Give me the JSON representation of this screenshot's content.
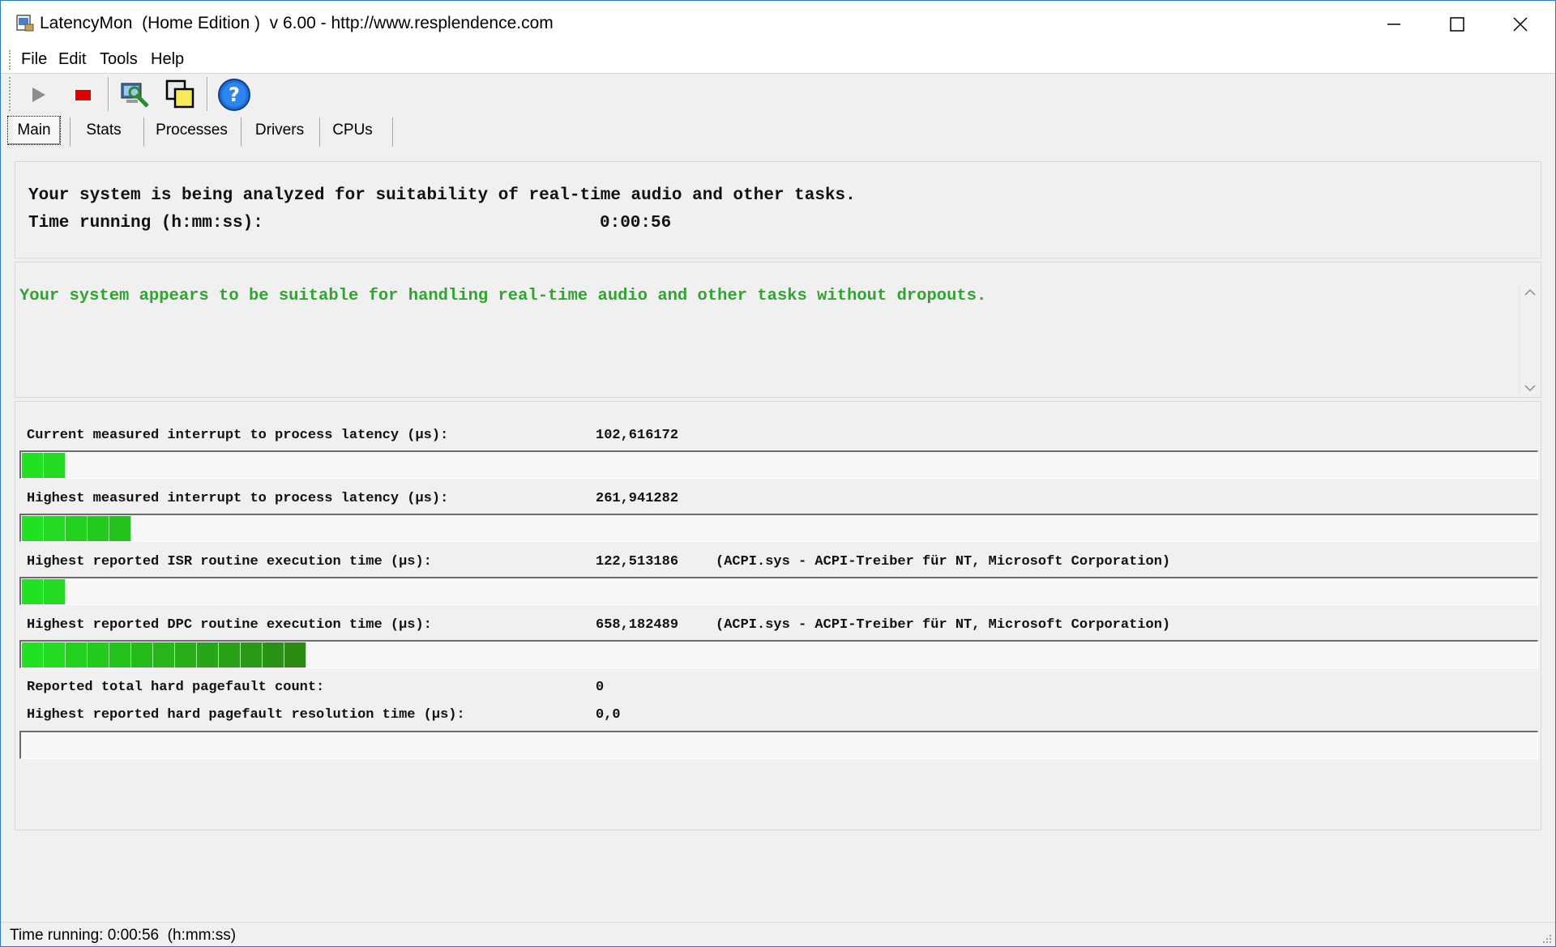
{
  "window": {
    "title": "LatencyMon  (Home Edition )  v 6.00 - http://www.resplendence.com",
    "minimize_icon": "minimize-icon",
    "maximize_icon": "maximize-icon",
    "close_icon": "close-icon"
  },
  "menu": {
    "items": [
      "File",
      "Edit",
      "Tools",
      "Help"
    ]
  },
  "toolbar": {
    "buttons": [
      {
        "name": "start",
        "icon": "play-icon"
      },
      {
        "name": "stop",
        "icon": "stop-icon"
      },
      {
        "name": "analyze",
        "icon": "computer-analyze-icon"
      },
      {
        "name": "windows",
        "icon": "window-stack-icon"
      },
      {
        "name": "help",
        "icon": "help-icon"
      }
    ]
  },
  "tabs": [
    {
      "label": "Main",
      "active": true
    },
    {
      "label": "Stats",
      "active": false
    },
    {
      "label": "Processes",
      "active": false
    },
    {
      "label": "Drivers",
      "active": false
    },
    {
      "label": "CPUs",
      "active": false
    }
  ],
  "main": {
    "analysis_text": "Your system is being analyzed for suitability of real-time audio and other tasks.",
    "time_label": "Time running (h:mm:ss):",
    "time_value": "0:00:56",
    "verdict": "Your system appears to be suitable for handling real-time audio and other tasks without dropouts.",
    "verdict_color": "#2fa52f",
    "metrics": [
      {
        "label": "Current measured interrupt to process latency (µs):",
        "value": "102,616172",
        "extra": "",
        "segments": 2
      },
      {
        "label": "Highest measured interrupt to process latency (µs):",
        "value": "261,941282",
        "extra": "",
        "segments": 5
      },
      {
        "label": "Highest reported ISR routine execution time (µs):",
        "value": "122,513186",
        "extra": "(ACPI.sys - ACPI-Treiber für NT, Microsoft Corporation)",
        "segments": 2
      },
      {
        "label": "Highest reported DPC routine execution time (µs):",
        "value": "658,182489",
        "extra": "(ACPI.sys - ACPI-Treiber für NT, Microsoft Corporation)",
        "segments": 13
      }
    ],
    "pagefault_count_label": "Reported total hard pagefault count:",
    "pagefault_count_value": "0",
    "pagefault_time_label": "Highest reported hard pagefault resolution time (µs):",
    "pagefault_time_value": "0,0",
    "pagefault_segments": 0
  },
  "statusbar": {
    "text": "Time running: 0:00:56  (h:mm:ss)"
  },
  "colors": {
    "bar_green_light": "#22e022",
    "bar_green_dark": "#2a8a12",
    "accent_border": "#2b79c9"
  }
}
